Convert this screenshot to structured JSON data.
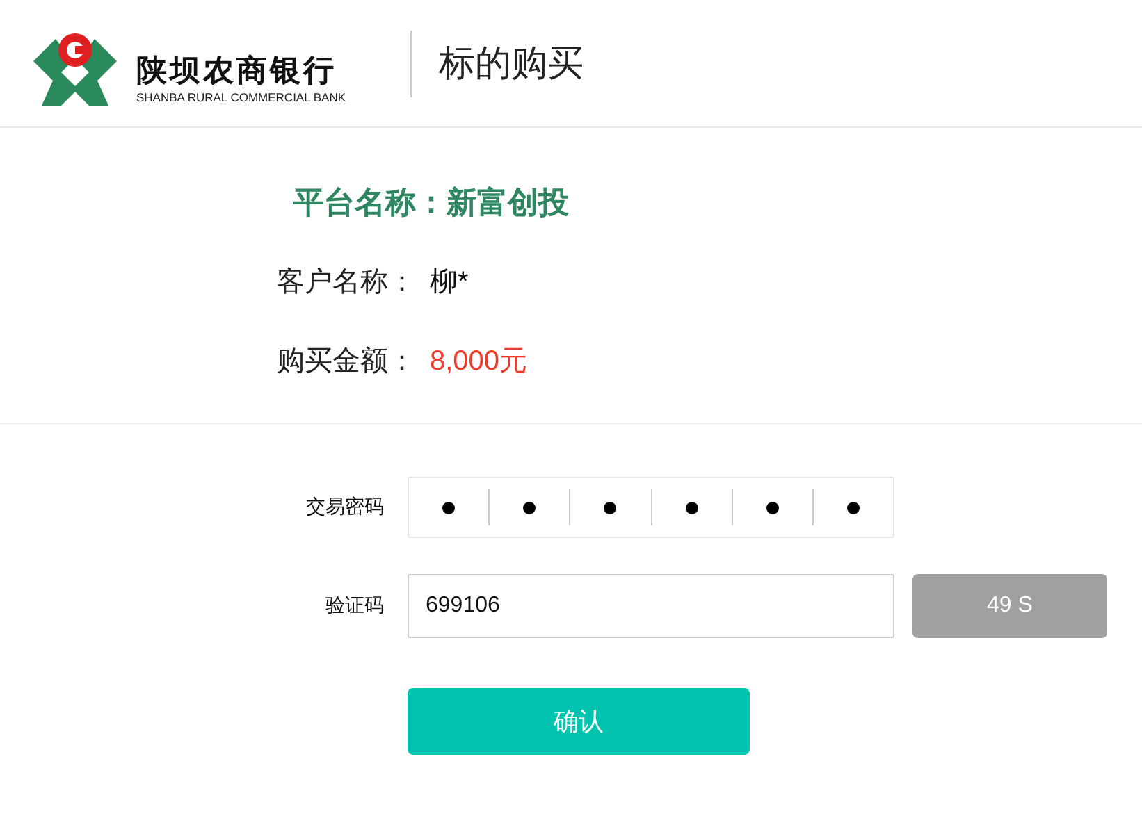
{
  "header": {
    "bank_name": "陕坝农商银行",
    "bank_name_en": "SHANBA RURAL COMMERCIAL BANK",
    "page_title": "标的购买"
  },
  "summary": {
    "platform": "平台名称：新富创投",
    "fields": [
      {
        "label": "客户名称：",
        "value": "柳*",
        "kind": "plain"
      },
      {
        "label": "购买金额：",
        "value": "8,000元",
        "kind": "amount"
      }
    ]
  },
  "form": {
    "password": {
      "label": "交易密码",
      "cells": [
        {
          "filled": true
        },
        {
          "filled": true
        },
        {
          "filled": true
        },
        {
          "filled": true
        },
        {
          "filled": true
        },
        {
          "filled": true
        }
      ]
    },
    "code": {
      "label": "验证码",
      "value": "699106",
      "countdown": "49 S",
      "countdown_disabled": true
    },
    "confirm": "确认"
  }
}
